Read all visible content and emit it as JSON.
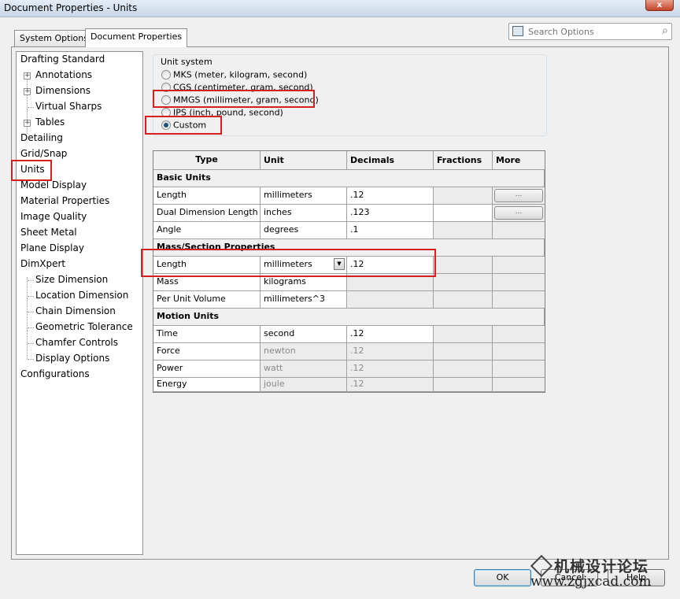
{
  "window": {
    "title": "Document Properties - Units",
    "close_label": "x"
  },
  "tabs": [
    {
      "label": "System Options",
      "active": false
    },
    {
      "label": "Document Properties",
      "active": true
    }
  ],
  "search": {
    "placeholder": "Search Options"
  },
  "tree": {
    "items": [
      {
        "label": "Drafting Standard"
      },
      {
        "label": "Annotations"
      },
      {
        "label": "Dimensions"
      },
      {
        "label": "Virtual Sharps"
      },
      {
        "label": "Tables"
      },
      {
        "label": "Detailing"
      },
      {
        "label": "Grid/Snap"
      },
      {
        "label": "Units",
        "selected": true
      },
      {
        "label": "Model Display"
      },
      {
        "label": "Material Properties"
      },
      {
        "label": "Image Quality"
      },
      {
        "label": "Sheet Metal"
      },
      {
        "label": "Plane Display"
      },
      {
        "label": "DimXpert"
      },
      {
        "label": "Size Dimension"
      },
      {
        "label": "Location Dimension"
      },
      {
        "label": "Chain Dimension"
      },
      {
        "label": "Geometric Tolerance"
      },
      {
        "label": "Chamfer Controls"
      },
      {
        "label": "Display Options"
      },
      {
        "label": "Configurations"
      }
    ]
  },
  "unit_system": {
    "legend": "Unit system",
    "options": [
      {
        "label": "MKS  (meter, kilogram, second)",
        "checked": false
      },
      {
        "label": "CGS  (centimeter, gram, second)",
        "checked": false
      },
      {
        "label": "MMGS (millimeter, gram, second)",
        "checked": false
      },
      {
        "label": "IPS  (inch, pound, second)",
        "checked": false
      },
      {
        "label": "Custom",
        "checked": true
      }
    ]
  },
  "grid": {
    "headers": [
      "Type",
      "Unit",
      "Decimals",
      "Fractions",
      "More"
    ],
    "sections": {
      "basic": "Basic Units",
      "mass": "Mass/Section Properties",
      "motion": "Motion Units"
    },
    "rows": {
      "length": {
        "type": "Length",
        "unit": "millimeters",
        "decimals": ".12"
      },
      "dual": {
        "type": "Dual Dimension Length",
        "unit": "inches",
        "decimals": ".123"
      },
      "angle": {
        "type": "Angle",
        "unit": "degrees",
        "decimals": ".1"
      },
      "mass_length": {
        "type": "Length",
        "unit": "millimeters",
        "decimals": ".12"
      },
      "mass": {
        "type": "Mass",
        "unit": "kilograms",
        "decimals": ""
      },
      "per_volume": {
        "type": "Per Unit Volume",
        "unit": "millimeters^3",
        "decimals": ""
      },
      "time": {
        "type": "Time",
        "unit": "second",
        "decimals": ".12"
      },
      "force": {
        "type": "Force",
        "unit": "newton",
        "decimals": ".12"
      },
      "power": {
        "type": "Power",
        "unit": "watt",
        "decimals": ".12"
      },
      "energy": {
        "type": "Energy",
        "unit": "joule",
        "decimals": ".12"
      }
    },
    "more_button_label": "..."
  },
  "buttons": {
    "ok": "OK",
    "cancel": "Cancel",
    "help": "Help"
  },
  "watermark": {
    "line1": "机械设计论坛",
    "line2": "www.zgjxcad.com"
  },
  "colors": {
    "highlight": "#d62020",
    "selection": "#1c5180"
  }
}
